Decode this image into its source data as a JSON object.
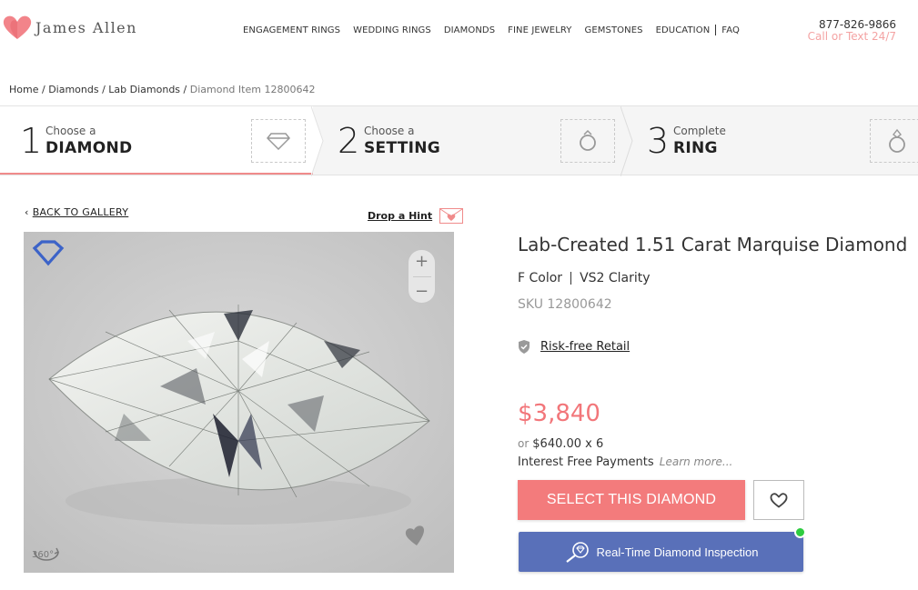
{
  "header": {
    "logo_text": "James Allen",
    "nav": [
      "ENGAGEMENT RINGS",
      "WEDDING RINGS",
      "DIAMONDS",
      "FINE JEWELRY",
      "GEMSTONES",
      "EDUCATION",
      "FAQ"
    ],
    "phone": "877-826-9866",
    "call_text": "Call or Text 24/7"
  },
  "breadcrumb": {
    "items": [
      "Home",
      "Diamonds",
      "Lab Diamonds"
    ],
    "current": "Diamond Item 12800642"
  },
  "steps": [
    {
      "num": "1",
      "small": "Choose a",
      "big": "DIAMOND",
      "icon": "diamond-outline-icon"
    },
    {
      "num": "2",
      "small": "Choose a",
      "big": "SETTING",
      "icon": "ring-setting-icon"
    },
    {
      "num": "3",
      "small": "Complete",
      "big": "RING",
      "icon": "ring-icon"
    }
  ],
  "gallery": {
    "back_label": "BACK TO GALLERY",
    "hint_label": "Drop a Hint",
    "zoom_in": "+",
    "zoom_out": "−"
  },
  "product": {
    "title": "Lab-Created 1.51 Carat Marquise Diamond",
    "color": "F Color",
    "clarity": "VS2 Clarity",
    "sku": "SKU 12800642",
    "risk_label": "Risk-free Retail",
    "price": "$3,840",
    "or_label": "or",
    "monthly": "$640.00 x 6",
    "interest_label": "Interest Free Payments",
    "learn_more": "Learn more..."
  },
  "actions": {
    "select_label": "SELECT THIS DIAMOND",
    "inspect_label": "Real-Time Diamond Inspection"
  },
  "colors": {
    "accent": "#f37b7c",
    "inspect": "#5970b9",
    "online": "#2ecc40"
  }
}
